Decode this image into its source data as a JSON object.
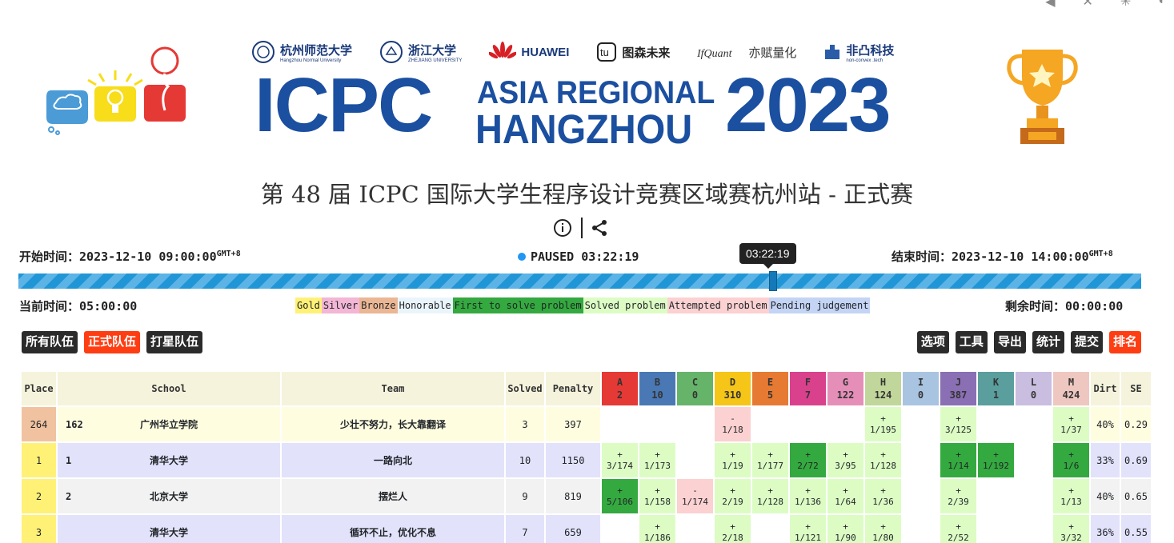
{
  "banner": {
    "icpc": "ICPC",
    "asia": "ASIA REGIONAL",
    "city": "HANGZHOU",
    "year": "2023",
    "sponsors": [
      {
        "name": "杭州师范大学",
        "sub": "Hangzhou Normal University"
      },
      {
        "name": "浙江大学",
        "sub": "ZHEJIANG UNIVERSITY"
      },
      {
        "name": "HUAWEI",
        "sub": ""
      },
      {
        "name": "图森未来",
        "sub": ""
      },
      {
        "name": "亦赋量化",
        "sub": ""
      },
      {
        "name": "非凸科技",
        "sub": "non-convex .tech"
      }
    ]
  },
  "title": "第 48 届 ICPC 国际大学生程序设计竞赛区域赛杭州站 - 正式赛",
  "times": {
    "start_label": "开始时间：",
    "start_value": "2023-12-10 09:00:00",
    "gmt": "GMT+8",
    "end_label": "结束时间：",
    "end_value": "2023-12-10 14:00:00",
    "status": "PAUSED 03:22:19",
    "tooltip": "03:22:19",
    "current_label": "当前时间：",
    "current_value": "05:00:00",
    "remaining_label": "剩余时间：",
    "remaining_value": "00:00:00",
    "progress_fraction": 0.672
  },
  "legend": [
    "Gold",
    "Silver",
    "Bronze",
    "Honorable",
    "First to solve problem",
    "Solved problem",
    "Attempted problem",
    "Pending judgement"
  ],
  "filters": [
    "所有队伍",
    "正式队伍",
    "打星队伍"
  ],
  "tools": [
    "选项",
    "工具",
    "导出",
    "统计",
    "提交",
    "排名"
  ],
  "columns": {
    "place": "Place",
    "school": "School",
    "team": "Team",
    "solved": "Solved",
    "penalty": "Penalty",
    "dirt": "Dirt",
    "se": "SE"
  },
  "problems": [
    {
      "id": "A",
      "count": "2",
      "color": "#e53935"
    },
    {
      "id": "B",
      "count": "10",
      "color": "#4a78b5"
    },
    {
      "id": "C",
      "count": "0",
      "color": "#66b36a"
    },
    {
      "id": "D",
      "count": "310",
      "color": "#f5c518"
    },
    {
      "id": "E",
      "count": "5",
      "color": "#e67a33"
    },
    {
      "id": "F",
      "count": "7",
      "color": "#d9418c"
    },
    {
      "id": "G",
      "count": "122",
      "color": "#e58fb8"
    },
    {
      "id": "H",
      "count": "124",
      "color": "#c0d69a"
    },
    {
      "id": "I",
      "count": "0",
      "color": "#a9c4e0"
    },
    {
      "id": "J",
      "count": "387",
      "color": "#8a6fb5"
    },
    {
      "id": "K",
      "count": "1",
      "color": "#5a9e9e"
    },
    {
      "id": "L",
      "count": "0",
      "color": "#c9bde0"
    },
    {
      "id": "M",
      "count": "424",
      "color": "#eec7c0"
    }
  ],
  "rows": [
    {
      "place": "264",
      "rank": "162",
      "school": "广州华立学院",
      "team": "少壮不努力，长大靠翻译",
      "solved": "3",
      "penalty": "397",
      "dirt": "40%",
      "se": "0.29",
      "cells": [
        [
          "",
          ""
        ],
        [
          "",
          ""
        ],
        [
          "",
          ""
        ],
        [
          "-",
          "1/18"
        ],
        [
          "",
          ""
        ],
        [
          "",
          ""
        ],
        [
          "",
          ""
        ],
        [
          "+",
          "1/195"
        ],
        [
          "",
          ""
        ],
        [
          "+",
          "3/125"
        ],
        [
          "",
          ""
        ],
        [
          "",
          ""
        ],
        [
          "+",
          "1/37"
        ]
      ]
    },
    {
      "place": "1",
      "rank": "1",
      "school": "清华大学",
      "team": "一路向北",
      "solved": "10",
      "penalty": "1150",
      "dirt": "33%",
      "se": "0.69",
      "cells": [
        [
          "+",
          "3/174"
        ],
        [
          "+",
          "1/173"
        ],
        [
          "",
          ""
        ],
        [
          "+",
          "1/19"
        ],
        [
          "+",
          "1/177"
        ],
        [
          "+",
          "2/72"
        ],
        [
          "+",
          "3/95"
        ],
        [
          "+",
          "1/128"
        ],
        [
          "",
          ""
        ],
        [
          "+",
          "1/14"
        ],
        [
          "+",
          "1/192"
        ],
        [
          "",
          ""
        ],
        [
          "+",
          "1/6"
        ]
      ]
    },
    {
      "place": "2",
      "rank": "2",
      "school": "北京大学",
      "team": "摆烂人",
      "solved": "9",
      "penalty": "819",
      "dirt": "40%",
      "se": "0.65",
      "cells": [
        [
          "+",
          "5/106"
        ],
        [
          "+",
          "1/158"
        ],
        [
          "-",
          "1/174"
        ],
        [
          "+",
          "2/19"
        ],
        [
          "+",
          "1/128"
        ],
        [
          "+",
          "1/136"
        ],
        [
          "+",
          "1/64"
        ],
        [
          "+",
          "1/36"
        ],
        [
          "",
          ""
        ],
        [
          "+",
          "2/39"
        ],
        [
          "",
          ""
        ],
        [
          "",
          ""
        ],
        [
          "+",
          "1/13"
        ]
      ]
    },
    {
      "place": "3",
      "rank": "",
      "school": "清华大学",
      "team": "循环不止，优化不息",
      "solved": "7",
      "penalty": "659",
      "dirt": "36%",
      "se": "0.55",
      "cells": [
        [
          "",
          ""
        ],
        [
          "+",
          "1/186"
        ],
        [
          "",
          ""
        ],
        [
          "+",
          "2/18"
        ],
        [
          "",
          ""
        ],
        [
          "+",
          "1/121"
        ],
        [
          "+",
          "1/90"
        ],
        [
          "+",
          "1/80"
        ],
        [
          "",
          ""
        ],
        [
          "+",
          "2/52"
        ],
        [
          "",
          ""
        ],
        [
          "",
          ""
        ],
        [
          "+",
          "3/32"
        ]
      ]
    }
  ],
  "styles": {
    "row_status": [
      "first",
      "first",
      "solved",
      "attempted",
      "solved",
      "first",
      "solved",
      "solved",
      "first",
      "first",
      "solved"
    ],
    "place_colors": [
      "#f1c29f",
      "#fff176",
      "#fff176",
      "#fff176"
    ],
    "row_bgs": [
      "#fffde0",
      "#e2e2fb",
      "#f2f2f2",
      "#e2e2fb"
    ],
    "first_cells": [
      [
        1,
        5
      ],
      [
        1,
        9
      ],
      [
        1,
        10
      ],
      [
        1,
        12
      ],
      [
        2,
        0
      ]
    ]
  }
}
